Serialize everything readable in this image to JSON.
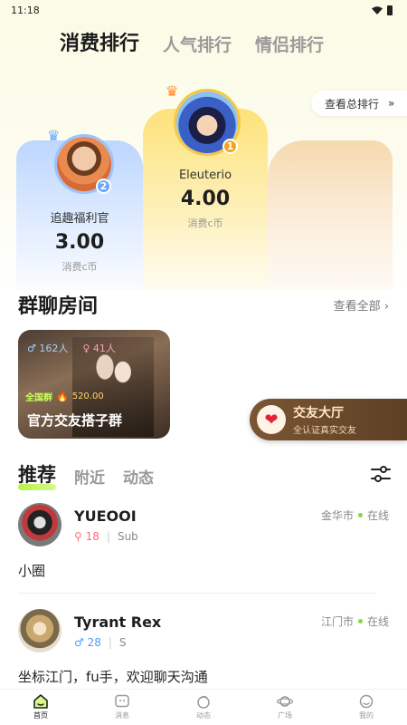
{
  "status_bar": {
    "time": "11:18"
  },
  "rank_tabs": [
    {
      "label": "消费排行",
      "active": true
    },
    {
      "label": "人气排行",
      "active": false
    },
    {
      "label": "情侣排行",
      "active": false
    }
  ],
  "all_rank_label": "查看总排行",
  "all_rank_chevron": "»",
  "podium": {
    "first": {
      "rank": "1",
      "name": "Eleuterio",
      "value": "4.00",
      "unit": "消费c币"
    },
    "second": {
      "rank": "2",
      "name": "追趣福利官",
      "value": "3.00",
      "unit": "消费c币"
    }
  },
  "group_section": {
    "title": "群聊房间",
    "link": "查看全部",
    "link_chevron": "›",
    "card": {
      "male_count": "162人",
      "female_count": "41人",
      "tag": "全国群",
      "coins": "520.00",
      "name": "官方交友搭子群"
    }
  },
  "friend_hall": {
    "title": "交友大厅",
    "subtitle": "全认证真实交友"
  },
  "feed_tabs": [
    {
      "label": "推荐",
      "active": true
    },
    {
      "label": "附近",
      "active": false
    },
    {
      "label": "动态",
      "active": false
    }
  ],
  "users": [
    {
      "name": "YUEOOI",
      "gender_symbol": "⚲",
      "age": "18",
      "role": "Sub",
      "city": "金华市",
      "status": "在线",
      "bio": "小圈"
    },
    {
      "name": "Tyrant Rex",
      "gender_symbol": "♂",
      "age": "28",
      "role": "S",
      "city": "江门市",
      "status": "在线",
      "bio": "坐标江门，fu手，欢迎聊天沟通"
    }
  ],
  "bottom_nav": [
    {
      "label": "首页",
      "icon": "home-icon",
      "active": true
    },
    {
      "label": "消息",
      "icon": "message-icon",
      "active": false
    },
    {
      "label": "动态",
      "icon": "feed-icon",
      "active": false
    },
    {
      "label": "广场",
      "icon": "planet-icon",
      "active": false
    },
    {
      "label": "我的",
      "icon": "profile-icon",
      "active": false
    }
  ]
}
